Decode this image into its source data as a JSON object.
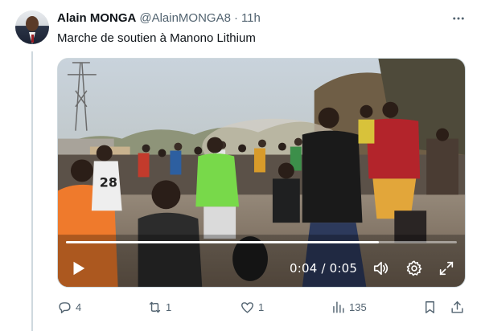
{
  "tweet": {
    "author_name": "Alain MONGA",
    "author_handle": "@AlainMONGA8",
    "separator": "·",
    "time": "11h",
    "text": "Marche de soutien à Manono Lithium"
  },
  "video": {
    "time_display": "0:04 / 0:05",
    "progress": 0.8
  },
  "actions": {
    "replies": "4",
    "reposts": "1",
    "likes": "1",
    "views": "135"
  },
  "icons": {
    "more": "more-dots-icon",
    "play": "play-icon",
    "volume": "volume-icon",
    "settings": "gear-icon",
    "fullscreen": "fullscreen-icon",
    "reply": "reply-icon",
    "repost": "repost-icon",
    "like": "heart-icon",
    "views": "views-icon",
    "bookmark": "bookmark-icon",
    "share": "share-icon"
  },
  "colors": {
    "text_primary": "#0f1419",
    "text_secondary": "#536471",
    "border": "#cfd9de"
  }
}
